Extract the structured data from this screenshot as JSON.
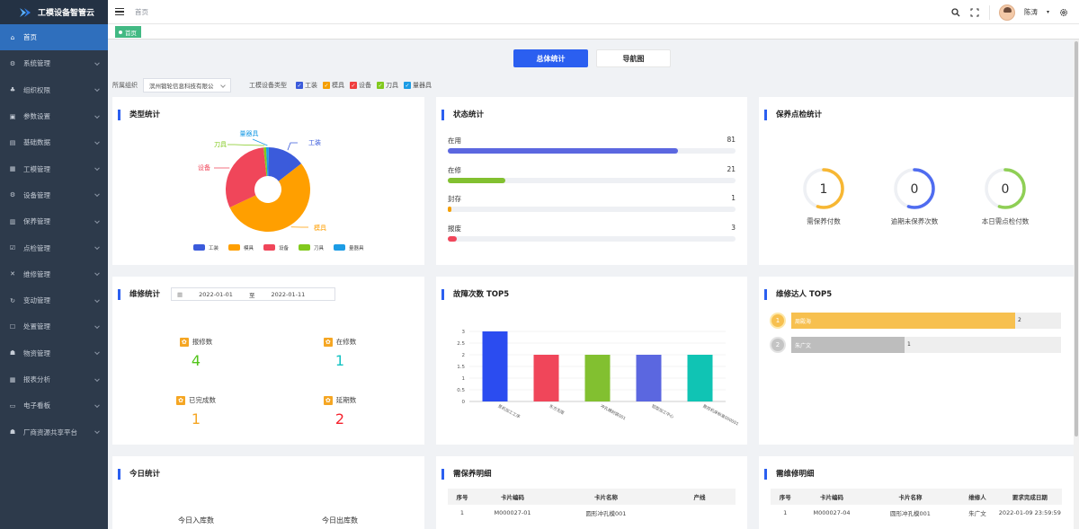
{
  "app": {
    "title": "工模设备智管云",
    "user": "陈涛",
    "breadcrumb": "首页",
    "active_tag": "首页"
  },
  "menu": [
    {
      "label": "首页",
      "icon": "home-icon",
      "active": true
    },
    {
      "label": "系统管理",
      "icon": "system-icon"
    },
    {
      "label": "组织权限",
      "icon": "org-icon"
    },
    {
      "label": "参数设置",
      "icon": "params-icon"
    },
    {
      "label": "基础数据",
      "icon": "data-icon"
    },
    {
      "label": "工模管理",
      "icon": "mold-icon"
    },
    {
      "label": "设备管理",
      "icon": "device-icon"
    },
    {
      "label": "保养管理",
      "icon": "maintain-icon"
    },
    {
      "label": "点检管理",
      "icon": "inspect-icon"
    },
    {
      "label": "维修管理",
      "icon": "repair-icon"
    },
    {
      "label": "变动管理",
      "icon": "change-icon"
    },
    {
      "label": "处置管理",
      "icon": "dispose-icon"
    },
    {
      "label": "物资管理",
      "icon": "material-icon"
    },
    {
      "label": "报表分析",
      "icon": "report-icon"
    },
    {
      "label": "电子看板",
      "icon": "board-icon"
    },
    {
      "label": "厂商资源共享平台",
      "icon": "share-icon"
    }
  ],
  "tabs": {
    "overall": "总体统计",
    "nav": "导航图"
  },
  "filters": {
    "org_label": "所属组织",
    "org_value": "滨州锻轮信息科技有限公",
    "type_label": "工模设备类型",
    "types": [
      {
        "label": "工装",
        "color": "#3b5bdb"
      },
      {
        "label": "模具",
        "color": "#f59f00"
      },
      {
        "label": "设备",
        "color": "#f03e3e"
      },
      {
        "label": "刀具",
        "color": "#82c91e"
      },
      {
        "label": "量器具",
        "color": "#1c9ce5"
      }
    ]
  },
  "cards": {
    "type_stats": "类型统计",
    "status_stats": "状态统计",
    "maint_stats": "保养点检统计",
    "repair_stats": "维修统计",
    "fault_top5": "故障次数 TOP5",
    "repairer_top5": "维修达人 TOP5",
    "today_stats": "今日统计",
    "need_maint": "需保养明细",
    "need_repair": "需维修明细"
  },
  "chart_data": [
    {
      "type": "pie",
      "title": "类型统计",
      "categories": [
        "工装",
        "模具",
        "设备",
        "刀具",
        "量器具"
      ],
      "values": [
        14,
        53,
        30,
        1,
        1
      ],
      "colors": [
        "#3b5bdb",
        "#ff9f00",
        "#f0465a",
        "#82c91e",
        "#1c9ce5"
      ],
      "legend": "bottom"
    },
    {
      "type": "bar",
      "title": "故障次数 TOP5",
      "categories": [
        "泵机加工工序",
        "东方无限",
        "冲孔模封装001",
        "铝型加工中心",
        "数控机床标准000001"
      ],
      "values": [
        3,
        2,
        2,
        2,
        2
      ],
      "colors": [
        "#2b4cf0",
        "#f0465a",
        "#82c030",
        "#5b67e0",
        "#10c4b4"
      ],
      "ylim": [
        0,
        3
      ],
      "yticks": [
        "0",
        "0.5",
        "1",
        "1.5",
        "2",
        "2.5",
        "3"
      ]
    }
  ],
  "status": [
    {
      "label": "在用",
      "value": 81,
      "frac": 0.8,
      "color": "#5b67e0"
    },
    {
      "label": "在修",
      "value": 21,
      "frac": 0.2,
      "color": "#82c030"
    },
    {
      "label": "封存",
      "value": 1,
      "frac": 0.012,
      "color": "#f59f00"
    },
    {
      "label": "报废",
      "value": 3,
      "frac": 0.03,
      "color": "#f0465a"
    }
  ],
  "maint": [
    {
      "label": "需保养付数",
      "value": "1",
      "color": "#f7b733",
      "frac": 0.55
    },
    {
      "label": "逾期未保养次数",
      "value": "0",
      "color": "#4f6cf0",
      "frac": 0.55
    },
    {
      "label": "本日需点检付数",
      "value": "0",
      "color": "#8fcf55",
      "frac": 0.55
    }
  ],
  "repair": {
    "date_start": "2022-01-01",
    "date_sep": "至",
    "date_end": "2022-01-11",
    "items": [
      {
        "label": "报修数",
        "value": "4",
        "color": "#52c41a"
      },
      {
        "label": "在修数",
        "value": "1",
        "color": "#13c2c2"
      },
      {
        "label": "已完成数",
        "value": "1",
        "color": "#f5a623"
      },
      {
        "label": "延期数",
        "value": "2",
        "color": "#f5222d"
      }
    ]
  },
  "repairers": [
    {
      "rank": "1",
      "name": "周殿海",
      "value": "2",
      "frac": 0.83,
      "color": "#f7c04f",
      "badge": "#f7c04f"
    },
    {
      "rank": "2",
      "name": "朱广文",
      "value": "1",
      "frac": 0.42,
      "color": "#bdbdbd",
      "badge": "#c4c4c4"
    }
  ],
  "today": {
    "in_label": "今日入库数",
    "out_label": "今日出库数"
  },
  "maint_table": {
    "headers": [
      "序号",
      "卡片编码",
      "卡片名称",
      "产线"
    ],
    "rows": [
      [
        "1",
        "M000027-01",
        "圆形冲孔模001",
        ""
      ]
    ]
  },
  "repair_table": {
    "headers": [
      "序号",
      "卡片编码",
      "卡片名称",
      "维修人",
      "要求完成日期"
    ],
    "rows": [
      [
        "1",
        "M000027-04",
        "圆形冲孔模001",
        "朱广文",
        "2022-01-09 23:59:59"
      ]
    ]
  }
}
